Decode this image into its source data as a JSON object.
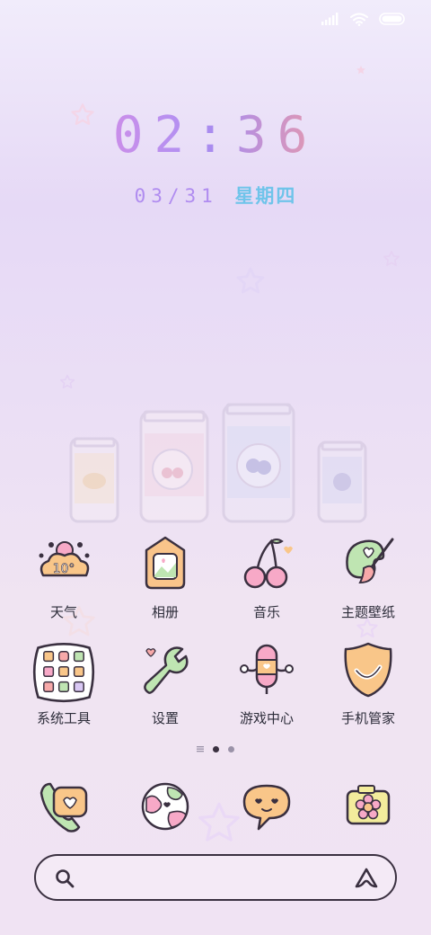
{
  "status_bar": {
    "signal_icon": "signal-bars-icon",
    "wifi_icon": "wifi-icon",
    "battery_icon": "battery-icon"
  },
  "clock": {
    "time": "02:36"
  },
  "date": {
    "day": "03/31",
    "weekday": "星期四"
  },
  "apps": [
    {
      "label": "天气",
      "icon": "weather-cloud-icon"
    },
    {
      "label": "相册",
      "icon": "gallery-icon"
    },
    {
      "label": "音乐",
      "icon": "cherry-music-icon"
    },
    {
      "label": "主题壁纸",
      "icon": "theme-brush-icon"
    },
    {
      "label": "系统工具",
      "icon": "system-tools-folder-icon"
    },
    {
      "label": "设置",
      "icon": "wrench-settings-icon"
    },
    {
      "label": "游戏中心",
      "icon": "game-center-icon"
    },
    {
      "label": "手机管家",
      "icon": "shield-manager-icon"
    }
  ],
  "page_indicator": {
    "pages": 3,
    "current": 2
  },
  "dock": [
    {
      "icon": "phone-icon"
    },
    {
      "icon": "browser-globe-icon"
    },
    {
      "icon": "messages-icon"
    },
    {
      "icon": "camera-icon"
    }
  ],
  "search": {
    "search_icon": "search-icon",
    "assistant_icon": "assistant-icon"
  },
  "colors": {
    "accent_purple": "#b08cf0",
    "accent_blue": "#6fc4ea",
    "accent_pink": "#ef8bdc"
  }
}
